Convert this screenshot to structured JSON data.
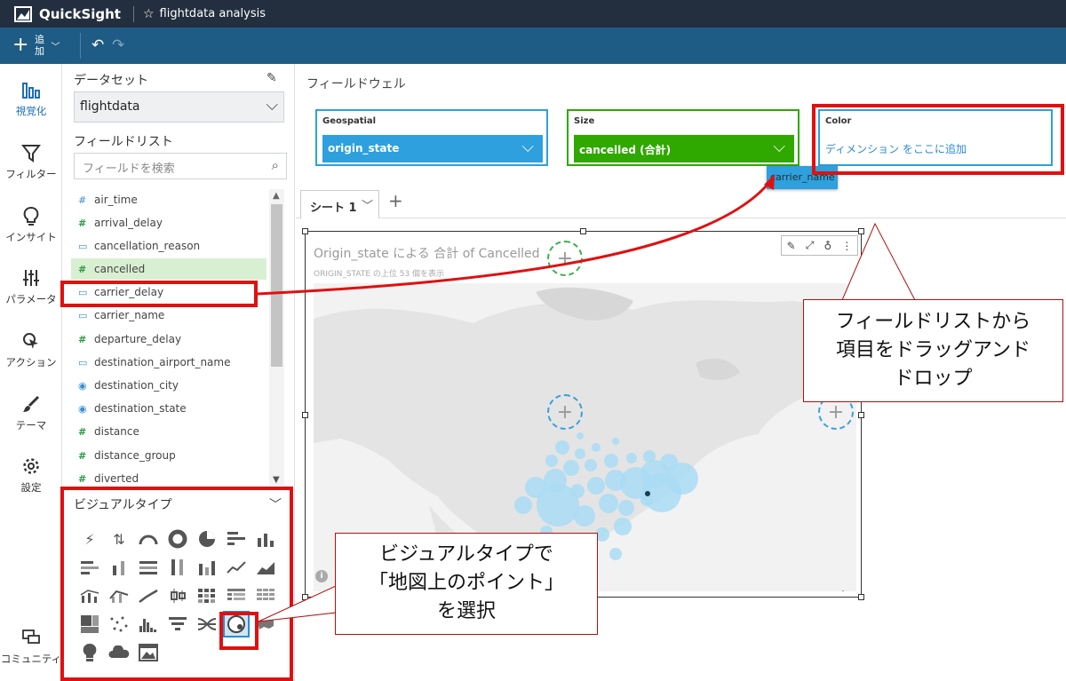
{
  "app": {
    "name": "QuickSight",
    "analysis_title": "flightdata analysis"
  },
  "toolbar": {
    "add_label": "追加"
  },
  "nav": [
    {
      "label": "視覚化",
      "icon": "bar-chart-icon",
      "active": true
    },
    {
      "label": "フィルター",
      "icon": "filter-icon"
    },
    {
      "label": "インサイト",
      "icon": "lightbulb-icon"
    },
    {
      "label": "パラメータ",
      "icon": "sliders-icon"
    },
    {
      "label": "アクション",
      "icon": "action-pointer-icon"
    },
    {
      "label": "テーマ",
      "icon": "brush-icon"
    },
    {
      "label": "設定",
      "icon": "gear-icon"
    },
    {
      "label": "コミュニティ",
      "icon": "community-chat-icon"
    }
  ],
  "dataset": {
    "heading": "データセット",
    "selected": "flightdata"
  },
  "field_list": {
    "heading": "フィールドリスト",
    "search_placeholder": "フィールドを検索",
    "fields": [
      {
        "name": "air_time",
        "type": "#"
      },
      {
        "name": "arrival_delay",
        "type": "#"
      },
      {
        "name": "cancellation_reason",
        "type": "▭"
      },
      {
        "name": "cancelled",
        "type": "#",
        "selected": true
      },
      {
        "name": "carrier_delay",
        "type": "▭"
      },
      {
        "name": "carrier_name",
        "type": "▭"
      },
      {
        "name": "departure_delay",
        "type": "#"
      },
      {
        "name": "destination_airport_name",
        "type": "▭"
      },
      {
        "name": "destination_city",
        "type": "◉"
      },
      {
        "name": "destination_state",
        "type": "◉"
      },
      {
        "name": "distance",
        "type": "#"
      },
      {
        "name": "distance_group",
        "type": "#"
      },
      {
        "name": "diverted",
        "type": "#"
      }
    ]
  },
  "visual_types": {
    "heading": "ビジュアルタイプ"
  },
  "field_wells": {
    "heading": "フィールドウェル",
    "geospatial": {
      "label": "Geospatial",
      "value": "origin_state"
    },
    "size": {
      "label": "Size",
      "value": "cancelled (合計)"
    },
    "color": {
      "label": "Color",
      "placeholder": "ディメンション をここに追加"
    },
    "drag_chip": "carrier_name"
  },
  "sheet": {
    "tab_label": "シート 1"
  },
  "visual": {
    "title": "Origin_state による 合計 of Cancelled",
    "subtitle": "ORIGIN_STATE の上位 53 個を表示"
  },
  "annotations": {
    "callout_drag": "フィールドリストから項目をドラッグアンドドロップ",
    "callout_drag_lines": [
      "フィールドリストから",
      "項目をドラッグアンド",
      "ドロップ"
    ],
    "callout_visual_lines": [
      "ビジュアルタイプで",
      "「地図上のポイント」",
      "を選択"
    ]
  },
  "colors": {
    "header": "#232f3e",
    "toolbar": "#1f5c85",
    "geo": "#2ea0dd",
    "size": "#2fa800",
    "annotation": "#e01010"
  }
}
